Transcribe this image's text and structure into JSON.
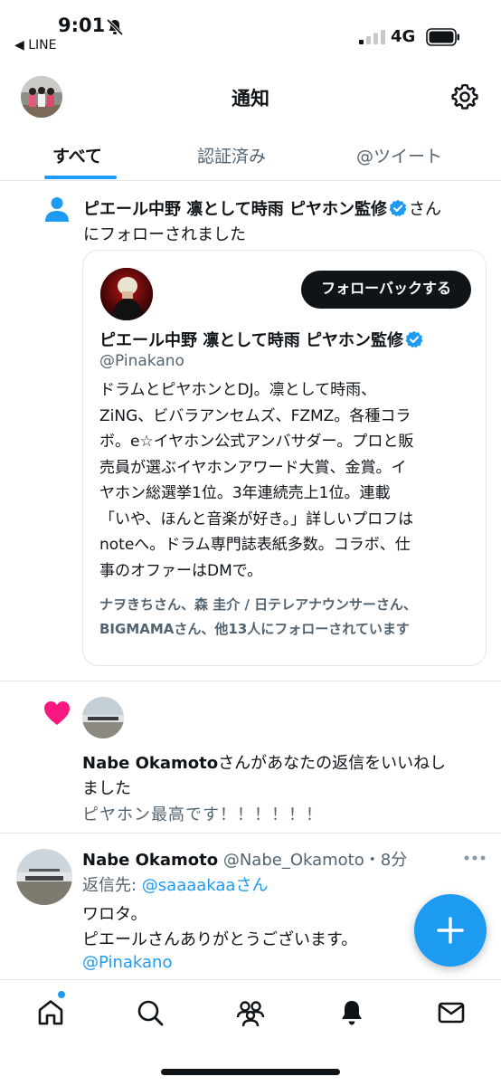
{
  "status_bar": {
    "time": "9:01",
    "back_app": "◀ LINE",
    "network": "4G"
  },
  "header": {
    "title": "通知"
  },
  "tabs": [
    {
      "label": "すべて",
      "active": true
    },
    {
      "label": "認証済み",
      "active": false
    },
    {
      "label": "@ツイート",
      "active": false
    }
  ],
  "follow_notification": {
    "name": "ピエール中野 凛として時雨 ピヤホン監修",
    "suffix_1": "さん",
    "suffix_2": "にフォローされました",
    "card": {
      "follow_back_label": "フォローバックする",
      "name": "ピエール中野 凛として時雨 ピヤホン監修",
      "handle": "@Pinakano",
      "bio_lines": [
        "ドラムとピヤホンとDJ。凛として時雨、",
        "ZiNG、ビバラアンセムズ、FZMZ。各種コラ",
        "ボ。e☆イヤホン公式アンバサダー。プロと販",
        "売員が選ぶイヤホンアワード大賞、金賞。イ",
        "ヤホン総選挙1位。3年連続売上1位。連載",
        "「いや、ほんと音楽が好き。」詳しいプロフは",
        "noteへ。ドラム専門誌表紙多数。コラボ、仕",
        "事のオファーはDMで。"
      ],
      "followed_by_lines": [
        "ナヲきちさん、森 圭介 / 日テレアナウンサーさん、",
        "BIGMAMAさん、他13人にフォローされています"
      ]
    }
  },
  "like_notification": {
    "name": "Nabe Okamoto",
    "text_1": "さんがあなたの返信をいいねし",
    "text_2": "ました",
    "quote": "ピヤホン最高です！！！！！！"
  },
  "reply_tweet": {
    "name": "Nabe Okamoto",
    "meta": "@Nabe_Okamoto・8分",
    "reply_to_label": "返信先: ",
    "reply_to_handle": "@saaaakaaさん",
    "body_lines": [
      "ワロタ。",
      "ピエールさんありがとうございます。"
    ],
    "mention": "@Pinakano"
  },
  "icons": {
    "status": [
      "bell-off-icon",
      "signal-icon",
      "battery-icon"
    ],
    "header": [
      "gear-icon"
    ],
    "tabbar": [
      "home-icon",
      "search-icon",
      "communities-icon",
      "bell-icon",
      "mail-icon"
    ],
    "fab": "plus-icon"
  },
  "colors": {
    "accent": "#1d9bf0",
    "text": "#0f1419",
    "muted": "#536471",
    "like": "#f91880",
    "divider": "#e7e7e7"
  }
}
